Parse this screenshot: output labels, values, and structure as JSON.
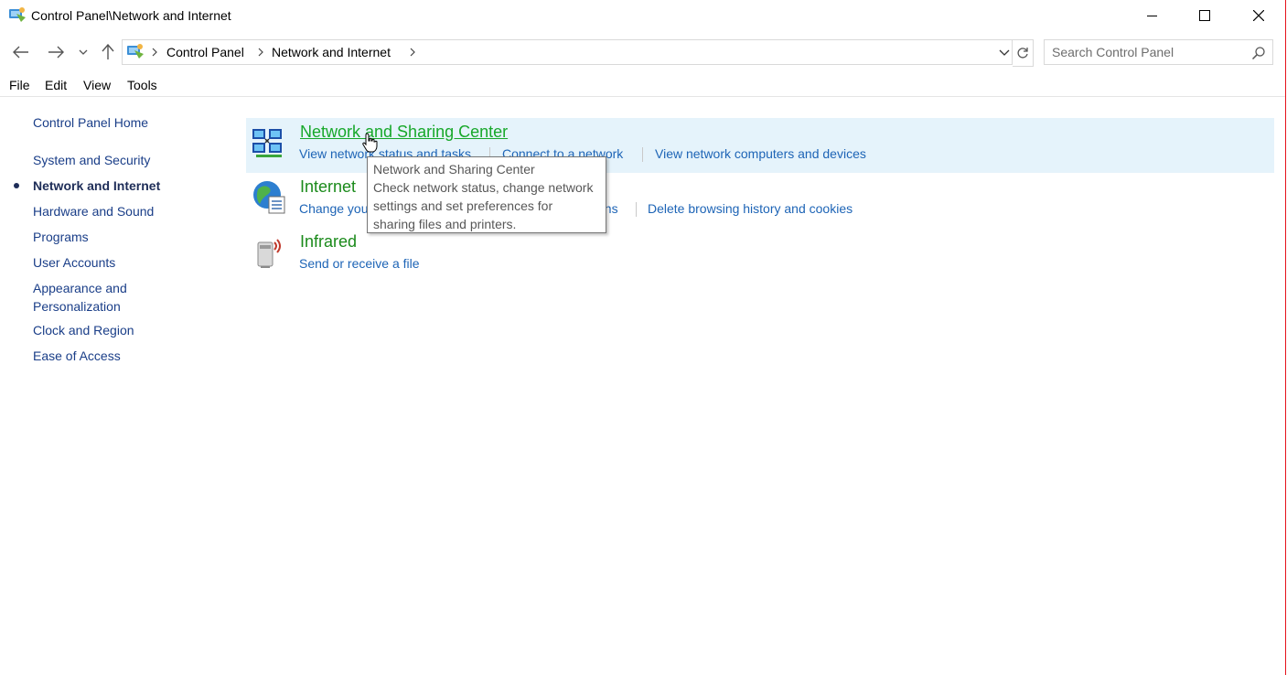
{
  "window": {
    "title": "Control Panel\\Network and Internet",
    "accent_border_color": "#e5121b",
    "controls": {
      "minimize_icon": "minimize-icon",
      "maximize_icon": "maximize-icon",
      "close_icon": "close-icon"
    }
  },
  "navigation": {
    "back_icon": "arrow-left-icon",
    "forward_icon": "arrow-right-icon",
    "recent_icon": "chevron-down-icon",
    "up_icon": "arrow-up-icon",
    "breadcrumbs": [
      "Control Panel",
      "Network and Internet"
    ],
    "refresh_icon": "refresh-icon",
    "search": {
      "placeholder": "Search Control Panel",
      "value": ""
    }
  },
  "menu": {
    "items": [
      "File",
      "Edit",
      "View",
      "Tools"
    ]
  },
  "sidebar": {
    "home": "Control Panel Home",
    "items": [
      {
        "label": "System and Security",
        "active": false
      },
      {
        "label": "Network and Internet",
        "active": true
      },
      {
        "label": "Hardware and Sound",
        "active": false
      },
      {
        "label": "Programs",
        "active": false
      },
      {
        "label": "User Accounts",
        "active": false
      },
      {
        "label": "Appearance and",
        "label2": "Personalization",
        "active": false
      },
      {
        "label": "Clock and Region",
        "active": false
      },
      {
        "label": "Ease of Access",
        "active": false
      }
    ]
  },
  "categories": [
    {
      "title": "Network and Sharing Center",
      "icon": "network-sharing-icon",
      "hovered": true,
      "tasks": [
        "View network status and tasks",
        "Connect to a network",
        "View network computers and devices"
      ]
    },
    {
      "title": "Internet Options",
      "title_visible": "Internet",
      "icon": "internet-globe-icon",
      "hovered": false,
      "tasks": [
        "Change your homepage",
        "Manage browser add-ons",
        "Delete browsing history and cookies"
      ],
      "tasks_visible": [
        "Change you",
        "ons",
        "Delete browsing history and cookies"
      ]
    },
    {
      "title": "Infrared",
      "icon": "infrared-icon",
      "hovered": false,
      "tasks": [
        "Send or receive a file"
      ]
    }
  ],
  "tooltip": {
    "lines": [
      "Network and Sharing Center",
      "Check network status, change network",
      "settings and set preferences for",
      "sharing files and printers."
    ]
  },
  "colors": {
    "link": "#1d64b6",
    "category_title": "#1a8a1a",
    "category_hover_title": "#17a82a",
    "hover_background": "#e5f3fb",
    "sidebar_link": "#1a3e88"
  }
}
